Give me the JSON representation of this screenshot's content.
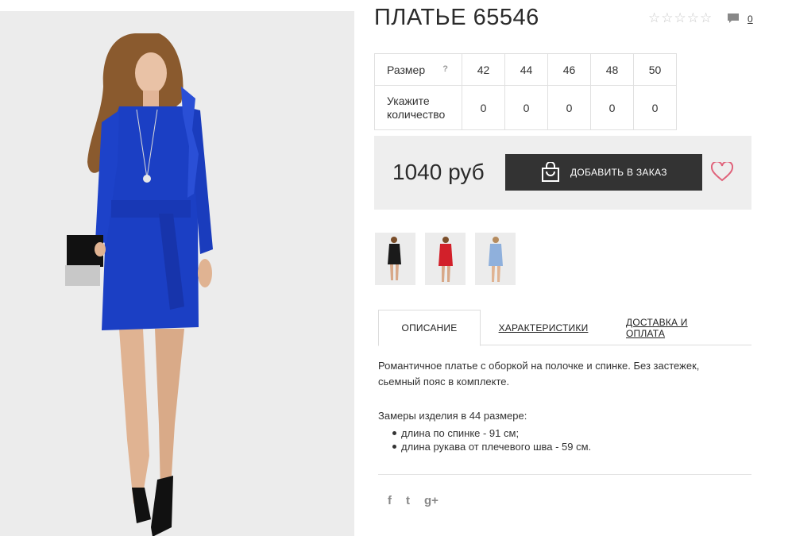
{
  "product": {
    "title": "ПЛАТЬЕ 65546",
    "rating_stars": 5,
    "comment_count": "0"
  },
  "size_table": {
    "size_label": "Размер",
    "help_mark": "?",
    "quantity_label": "Укажите количество",
    "sizes": [
      "42",
      "44",
      "46",
      "48",
      "50"
    ],
    "quantities": [
      "0",
      "0",
      "0",
      "0",
      "0"
    ]
  },
  "buy": {
    "price": "1040 руб",
    "add_button": "ДОБАВИТЬ В ЗАКАЗ"
  },
  "thumbnails": [
    {
      "color": "#1a1a1a",
      "name": "black-dress"
    },
    {
      "color": "#d2202a",
      "name": "red-dress"
    },
    {
      "color": "#8fb0dc",
      "name": "light-blue-dress"
    }
  ],
  "tabs": [
    "ОПИСАНИЕ",
    "ХАРАКТЕРИСТИКИ",
    "ДОСТАВКА И ОПЛАТА"
  ],
  "description": {
    "text": "Романтичное платье с оборкой на полочке и спинке. Без застежек, сьемный пояс в комплекте.",
    "measure_title": "Замеры изделия в 44 размере:",
    "measures": [
      "длина по спинке - 91 см;",
      "длина рукава от плечевого шва - 59 см."
    ]
  },
  "social": [
    "f",
    "t",
    "g+"
  ],
  "colors": {
    "dress_blue": "#1b3fc4",
    "button_dark": "#333333",
    "heart_pink": "#e0627a"
  }
}
